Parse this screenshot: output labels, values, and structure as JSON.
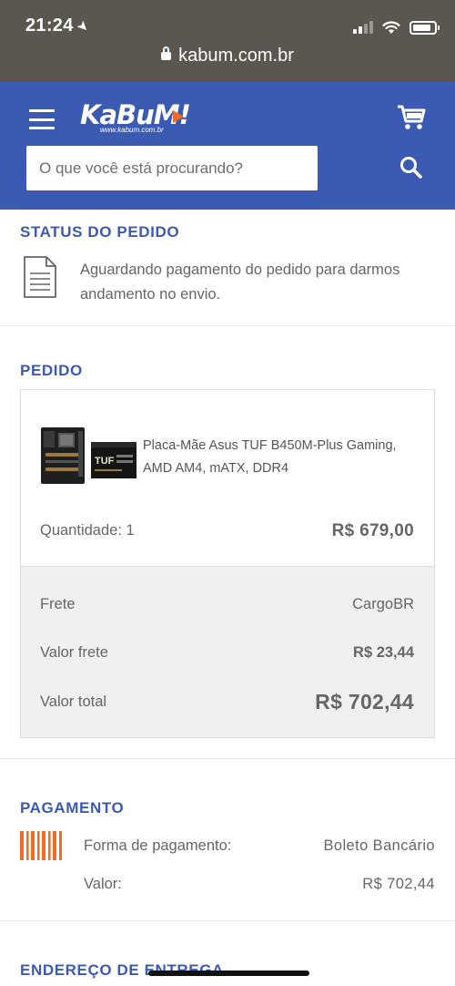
{
  "status_bar": {
    "time": "21:24"
  },
  "browser": {
    "url": "kabum.com.br"
  },
  "header": {
    "logo_text": "KaBuM!",
    "logo_subtext": "www.kabum.com.br",
    "search_placeholder": "O que você está procurando?"
  },
  "order_status": {
    "title": "STATUS DO PEDIDO",
    "message": "Aguardando pagamento do pedido para darmos andamento no envio."
  },
  "order": {
    "title": "PEDIDO",
    "product_name": "Placa-Mãe Asus TUF B450M-Plus Gaming, AMD AM4, mATX, DDR4",
    "quantity_label": "Quantidade: 1",
    "price": "R$ 679,00",
    "shipping_label": "Frete",
    "shipping_value": "CargoBR",
    "shipping_cost_label": "Valor frete",
    "shipping_cost_value": "R$ 23,44",
    "total_label": "Valor total",
    "total_value": "R$ 702,44"
  },
  "payment": {
    "title": "PAGAMENTO",
    "method_label": "Forma de pagamento:",
    "method_value": "Boleto Bancário",
    "amount_label": "Valor:",
    "amount_value": "R$ 702,44"
  },
  "delivery": {
    "title": "ENDEREÇO DE ENTREGA"
  },
  "colors": {
    "brand_blue": "#3b5bb3",
    "accent_orange": "#f26b22"
  }
}
